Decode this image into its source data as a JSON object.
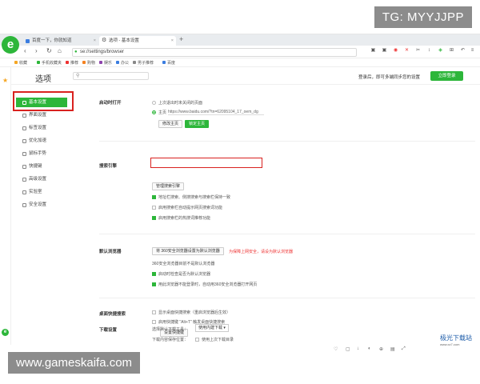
{
  "watermarks": {
    "top_right": "TG: MYYJJPP",
    "bottom_left": "www.gameskaifa.com",
    "corner_logo": "极光下载站",
    "corner_logo_sub": "www.xz7.com"
  },
  "tabs": [
    {
      "title": "百度一下，你就知道"
    },
    {
      "title": "选项 - 基本设置"
    }
  ],
  "address": {
    "url": "se://settings/browser"
  },
  "bookmarks": [
    "收藏",
    "手机收藏夹",
    "推荐",
    "购物",
    "娱乐",
    "办公",
    "男子推荐",
    "百度"
  ],
  "header": {
    "title": "选项",
    "login_hint": "登录后，即可多端同步您的设置",
    "login_button": "立即登录"
  },
  "nav": [
    {
      "label": "基本设置"
    },
    {
      "label": "界面设置"
    },
    {
      "label": "标签设置"
    },
    {
      "label": "优化加速"
    },
    {
      "label": "鼠标手势"
    },
    {
      "label": "快捷键"
    },
    {
      "label": "高级设置"
    },
    {
      "label": "实验室"
    },
    {
      "label": "安全设置"
    }
  ],
  "startup": {
    "title": "启动时打开",
    "option_last": "上次退出时未关闭的页面",
    "option_home": "主页",
    "home_url": "https://www.baidu.com/?tn=62095104_17_oem_dg",
    "btn_modify": "修改主页",
    "btn_lock": "锁定主页"
  },
  "search_engine": {
    "title": "搜索引擎",
    "btn_manage": "管理搜索引擎",
    "opt_sync": "地址栏搜索、侧搜搜索与搜索栏保持一致",
    "opt_suggest": "启用搜索栏自动提示网页搜索词功能",
    "opt_hot": "启用搜索栏的热搜词推荐功能"
  },
  "default_browser": {
    "title": "默认浏览器",
    "btn_set": "将 360安全浏览器设置为默认浏览器",
    "warning": "为保障上网安全，请设为默认浏览器",
    "status": "360安全浏览器目前不是默认浏览器",
    "opt_check": "启动时检查是否为默认浏览器",
    "opt_open": "用此浏览器不能登录时，自动用360安全浏览器打开网页"
  },
  "desktop_search": {
    "title": "桌面快捷搜索",
    "opt_show": "显示桌面快捷搜索（重启浏览器后生效）",
    "opt_hotkey": "启用快捷键 \"Alt+T\" 触发桌面快捷搜索",
    "btn_settings": "设置快捷键"
  },
  "download": {
    "title": "下载设置",
    "select_label": "选择默认下载工具：",
    "select_value": "使用内建下载",
    "save_label": "下载内容保存位置：",
    "save_opt": "使用上次下载目录"
  }
}
